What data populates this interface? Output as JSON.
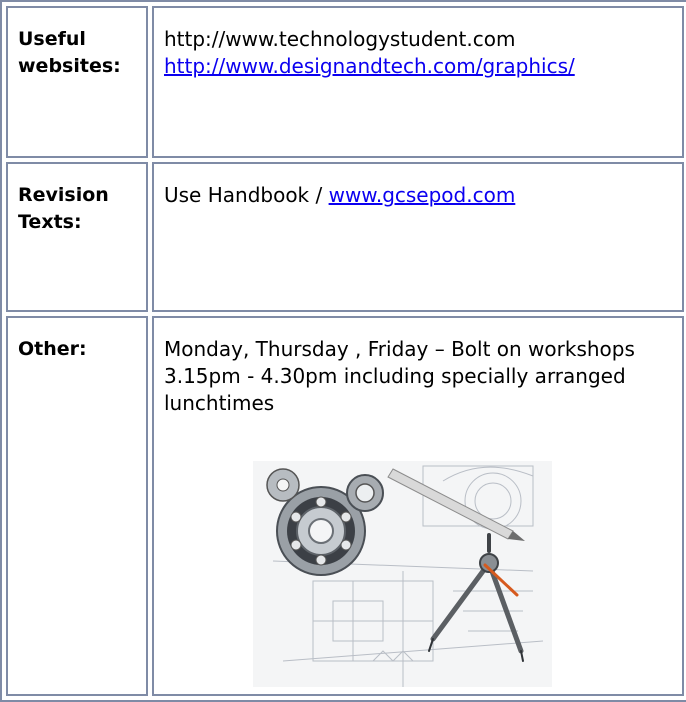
{
  "rows": [
    {
      "label": "Useful websites:",
      "lines": [
        {
          "text": "http://www.technologystudent.com",
          "link": false
        },
        {
          "text": "http://www.designandtech.com/graphics/",
          "link": true
        }
      ]
    },
    {
      "label": "Revision Texts:",
      "prefix": "Use Handbook / ",
      "link": "www.gcsepod.com"
    },
    {
      "label": "Other:",
      "text": "Monday, Thursday , Friday – Bolt on workshops 3.15pm - 4.30pm including specially arranged lunchtimes",
      "image": {
        "icon": "engineering-drawing-image"
      }
    }
  ],
  "colors": {
    "border": "#7f8ba6",
    "link": "#0b00f0"
  }
}
